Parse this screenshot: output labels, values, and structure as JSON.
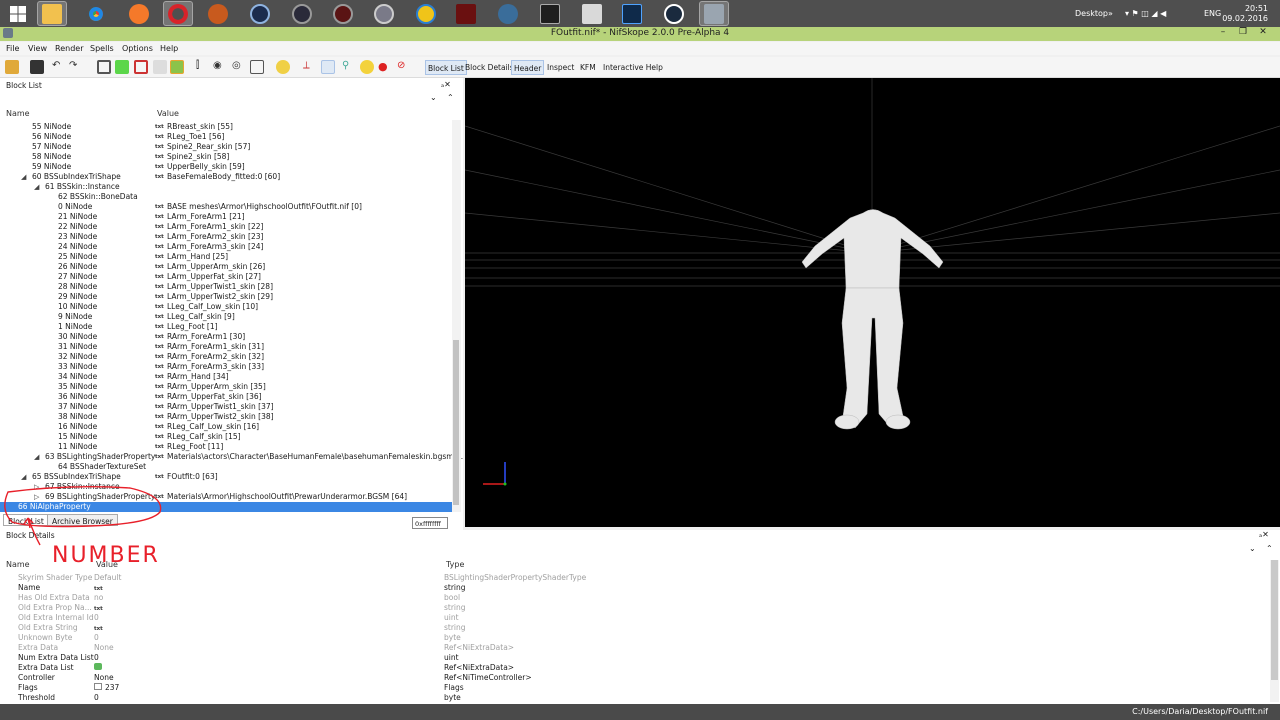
{
  "taskbar": {
    "desktop_label": "Desktop",
    "lang": "ENG",
    "time": "20:51",
    "date": "09.02.2016"
  },
  "window": {
    "title": "FOutfit.nif* - NifSkope 2.0.0 Pre-Alpha 4",
    "min": "–",
    "max": "❐",
    "close": "✕"
  },
  "menu": [
    "File",
    "View",
    "Render",
    "Spells",
    "Options",
    "Help"
  ],
  "toolbar": {
    "tabs": [
      "Block List",
      "Block Details",
      "Header",
      "Inspect",
      "KFM",
      "Interactive Help"
    ]
  },
  "block_list": {
    "title": "Block List",
    "col_name": "Name",
    "col_value": "Value",
    "txt_icon": "txt",
    "rows": [
      {
        "name": "55 NiNode",
        "value": "RBreast_skin [55]",
        "indent": 1,
        "arrow": ""
      },
      {
        "name": "56 NiNode",
        "value": "RLeg_Toe1 [56]",
        "indent": 1,
        "arrow": ""
      },
      {
        "name": "57 NiNode",
        "value": "Spine2_Rear_skin [57]",
        "indent": 1,
        "arrow": ""
      },
      {
        "name": "58 NiNode",
        "value": "Spine2_skin [58]",
        "indent": 1,
        "arrow": ""
      },
      {
        "name": "59 NiNode",
        "value": "UpperBelly_skin [59]",
        "indent": 1,
        "arrow": ""
      },
      {
        "name": "60 BSSubIndexTriShape",
        "value": "BaseFemaleBody_fitted:0 [60]",
        "indent": 1,
        "arrow": "◢"
      },
      {
        "name": "61 BSSkin::Instance",
        "value": "",
        "indent": 2,
        "arrow": "◢"
      },
      {
        "name": "62 BSSkin::BoneData",
        "value": "",
        "indent": 3,
        "arrow": ""
      },
      {
        "name": "0 NiNode",
        "value": "BASE meshes\\Armor\\HighschoolOutfit\\FOutfit.nif [0]",
        "indent": 3,
        "arrow": ""
      },
      {
        "name": "21 NiNode",
        "value": "LArm_ForeArm1 [21]",
        "indent": 3,
        "arrow": ""
      },
      {
        "name": "22 NiNode",
        "value": "LArm_ForeArm1_skin [22]",
        "indent": 3,
        "arrow": ""
      },
      {
        "name": "23 NiNode",
        "value": "LArm_ForeArm2_skin [23]",
        "indent": 3,
        "arrow": ""
      },
      {
        "name": "24 NiNode",
        "value": "LArm_ForeArm3_skin [24]",
        "indent": 3,
        "arrow": ""
      },
      {
        "name": "25 NiNode",
        "value": "LArm_Hand [25]",
        "indent": 3,
        "arrow": ""
      },
      {
        "name": "26 NiNode",
        "value": "LArm_UpperArm_skin [26]",
        "indent": 3,
        "arrow": ""
      },
      {
        "name": "27 NiNode",
        "value": "LArm_UpperFat_skin [27]",
        "indent": 3,
        "arrow": ""
      },
      {
        "name": "28 NiNode",
        "value": "LArm_UpperTwist1_skin [28]",
        "indent": 3,
        "arrow": ""
      },
      {
        "name": "29 NiNode",
        "value": "LArm_UpperTwist2_skin [29]",
        "indent": 3,
        "arrow": ""
      },
      {
        "name": "10 NiNode",
        "value": "LLeg_Calf_Low_skin [10]",
        "indent": 3,
        "arrow": ""
      },
      {
        "name": "9 NiNode",
        "value": "LLeg_Calf_skin [9]",
        "indent": 3,
        "arrow": ""
      },
      {
        "name": "1 NiNode",
        "value": "LLeg_Foot [1]",
        "indent": 3,
        "arrow": ""
      },
      {
        "name": "30 NiNode",
        "value": "RArm_ForeArm1 [30]",
        "indent": 3,
        "arrow": ""
      },
      {
        "name": "31 NiNode",
        "value": "RArm_ForeArm1_skin [31]",
        "indent": 3,
        "arrow": ""
      },
      {
        "name": "32 NiNode",
        "value": "RArm_ForeArm2_skin [32]",
        "indent": 3,
        "arrow": ""
      },
      {
        "name": "33 NiNode",
        "value": "RArm_ForeArm3_skin [33]",
        "indent": 3,
        "arrow": ""
      },
      {
        "name": "34 NiNode",
        "value": "RArm_Hand [34]",
        "indent": 3,
        "arrow": ""
      },
      {
        "name": "35 NiNode",
        "value": "RArm_UpperArm_skin [35]",
        "indent": 3,
        "arrow": ""
      },
      {
        "name": "36 NiNode",
        "value": "RArm_UpperFat_skin [36]",
        "indent": 3,
        "arrow": ""
      },
      {
        "name": "37 NiNode",
        "value": "RArm_UpperTwist1_skin [37]",
        "indent": 3,
        "arrow": ""
      },
      {
        "name": "38 NiNode",
        "value": "RArm_UpperTwist2_skin [38]",
        "indent": 3,
        "arrow": ""
      },
      {
        "name": "16 NiNode",
        "value": "RLeg_Calf_Low_skin [16]",
        "indent": 3,
        "arrow": ""
      },
      {
        "name": "15 NiNode",
        "value": "RLeg_Calf_skin [15]",
        "indent": 3,
        "arrow": ""
      },
      {
        "name": "11 NiNode",
        "value": "RLeg_Foot [11]",
        "indent": 3,
        "arrow": ""
      },
      {
        "name": "63 BSLightingShaderProperty",
        "value": "Materials\\actors\\Character\\BaseHumanFemale\\basehumanFemaleskin.bgsm ...",
        "indent": 2,
        "arrow": "◢"
      },
      {
        "name": "64 BSShaderTextureSet",
        "value": "",
        "indent": 3,
        "arrow": ""
      },
      {
        "name": "65 BSSubIndexTriShape",
        "value": "FOutfit:0 [63]",
        "indent": 1,
        "arrow": "◢"
      },
      {
        "name": "67 BSSkin::Instance",
        "value": "",
        "indent": 2,
        "arrow": "▷"
      },
      {
        "name": "69 BSLightingShaderProperty",
        "value": "Materials\\Armor\\HighschoolOutfit\\PrewarUnderarmor.BGSM [64]",
        "indent": 2,
        "arrow": "▷"
      },
      {
        "name": "66 NiAlphaProperty",
        "value": "",
        "indent": 0,
        "arrow": "",
        "selected": true
      }
    ],
    "tabs": [
      "Block List",
      "Archive Browser"
    ],
    "tooltip": "0xffffffff"
  },
  "annotation": {
    "text": "NUMBER",
    "color": "#e8202a"
  },
  "block_details": {
    "title": "Block Details",
    "col_name": "Name",
    "col_value": "Value",
    "col_type": "Type",
    "txt_icon": "txt",
    "rows": [
      {
        "name": "Skyrim Shader Type",
        "value": "Default",
        "type": "BSLightingShaderPropertyShaderType",
        "dim": true
      },
      {
        "name": "Name",
        "value": "",
        "txt": true,
        "type": "string",
        "dim": false
      },
      {
        "name": "Has Old Extra Data",
        "value": "no",
        "type": "bool",
        "dim": true
      },
      {
        "name": "Old Extra Prop Na...",
        "value": "",
        "txt": true,
        "type": "string",
        "dim": true
      },
      {
        "name": "Old Extra Internal Id",
        "value": "0",
        "type": "uint",
        "dim": true
      },
      {
        "name": "Old Extra String",
        "value": "",
        "txt": true,
        "type": "string",
        "dim": true
      },
      {
        "name": "Unknown Byte",
        "value": "0",
        "type": "byte",
        "dim": true
      },
      {
        "name": "Extra Data",
        "value": "None",
        "type": "Ref<NiExtraData>",
        "dim": true
      },
      {
        "name": "Num Extra Data List",
        "value": "0",
        "type": "uint",
        "dim": false
      },
      {
        "name": "Extra Data List",
        "value": "",
        "type": "Ref<NiExtraData>",
        "dim": false,
        "icon": true
      },
      {
        "name": "Controller",
        "value": "None",
        "type": "Ref<NiTimeController>",
        "dim": false
      },
      {
        "name": "Flags",
        "value": "237",
        "type": "Flags",
        "dim": false,
        "flag": true
      },
      {
        "name": "Threshold",
        "value": "0",
        "type": "byte",
        "dim": false
      }
    ]
  },
  "status": {
    "path": "C:/Users/Daria/Desktop/FOutfit.nif"
  }
}
